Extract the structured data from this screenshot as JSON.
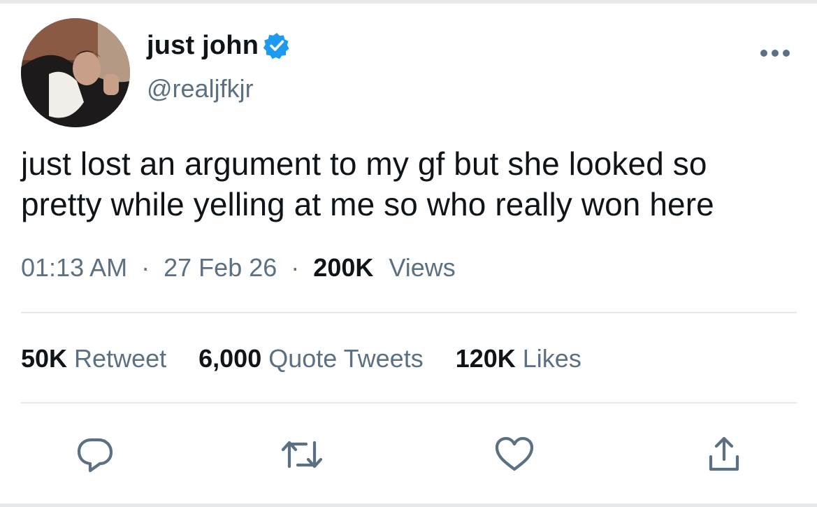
{
  "tweet": {
    "display_name": "just john",
    "handle": "@realjfkjr",
    "text": "just lost an argument to my gf but she looked so pretty while yelling at me so who really won here",
    "time": "01:13 AM",
    "date": "27 Feb 26",
    "separator": "·",
    "views_count": "200K",
    "views_label": "Views"
  },
  "stats": {
    "retweets_count": "50K",
    "retweets_label": "Retweet",
    "quotes_count": "6,000",
    "quotes_label": "Quote Tweets",
    "likes_count": "120K",
    "likes_label": "Likes"
  },
  "icons": {
    "verified": "verified-badge-icon",
    "more": "more-dots-icon",
    "reply": "reply-icon",
    "retweet": "retweet-icon",
    "like": "heart-icon",
    "share": "share-icon"
  },
  "colors": {
    "verified_blue": "#1d9bf0",
    "text_primary": "#0f1419",
    "text_secondary": "#5b7083",
    "divider": "#e6e8ea"
  }
}
